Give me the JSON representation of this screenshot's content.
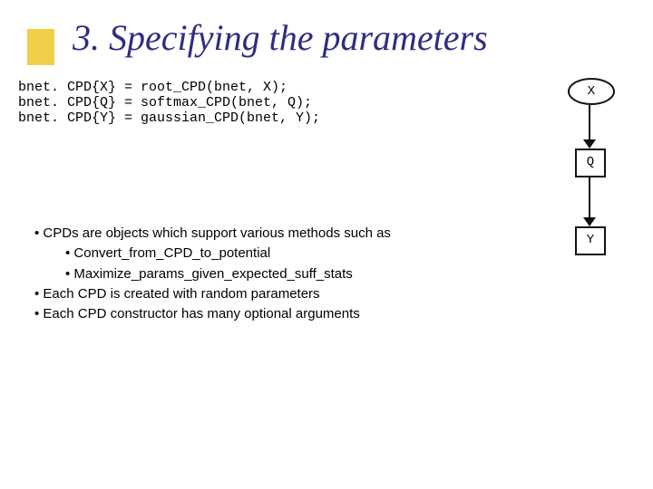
{
  "title": "3. Specifying the parameters",
  "code": {
    "l1": "bnet. CPD{X} = root_CPD(bnet, X);",
    "l2": "bnet. CPD{Q} = softmax_CPD(bnet, Q);",
    "l3": "bnet. CPD{Y} = gaussian_CPD(bnet, Y);"
  },
  "diagram": {
    "nodes": {
      "x": "X",
      "q": "Q",
      "y": "Y"
    }
  },
  "bullets": {
    "b1": "CPDs are objects which support various methods such as",
    "b1a": "Convert_from_CPD_to_potential",
    "b1b": "Maximize_params_given_expected_suff_stats",
    "b2": "Each CPD is created with random parameters",
    "b3": "Each CPD constructor has many optional arguments"
  }
}
